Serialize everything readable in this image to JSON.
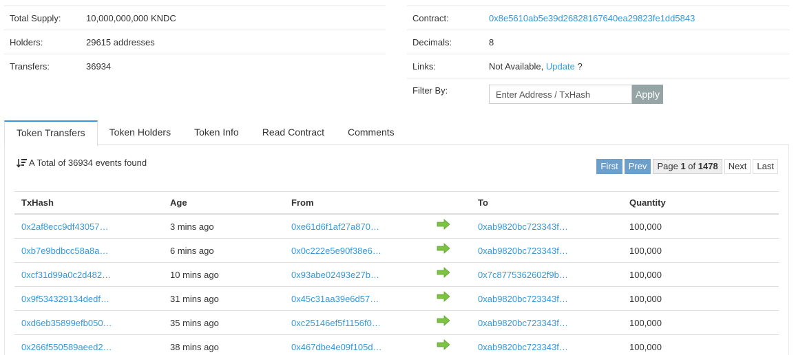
{
  "summary_left": [
    {
      "label": "Total Supply:",
      "value": "10,000,000,000 KNDC"
    },
    {
      "label": "Holders:",
      "value": "29615 addresses"
    },
    {
      "label": "Transfers:",
      "value": "36934"
    }
  ],
  "summary_right": {
    "contract_label": "Contract:",
    "contract_value": "0x8e5610ab5e39d26828167640ea29823fe1dd5843",
    "decimals_label": "Decimals:",
    "decimals_value": "8",
    "links_label": "Links:",
    "links_text": "Not Available,",
    "links_update": "Update",
    "links_q": "?",
    "filter_label": "Filter By:",
    "filter_placeholder": "Enter Address / TxHash",
    "apply_label": "Apply"
  },
  "tabs": [
    "Token Transfers",
    "Token Holders",
    "Token Info",
    "Read Contract",
    "Comments"
  ],
  "events_text": "A Total of 36934 events found",
  "pager": {
    "first": "First",
    "prev": "Prev",
    "page_prefix": "Page",
    "page_current": "1",
    "page_of": "of",
    "page_total": "1478",
    "next": "Next",
    "last": "Last"
  },
  "table": {
    "headers": [
      "TxHash",
      "Age",
      "From",
      "",
      "To",
      "Quantity"
    ],
    "rows": [
      {
        "txhash": "0x2af8ecc9df43057…",
        "age": "3 mins ago",
        "from": "0xe61d6f1af27a870…",
        "to": "0xab9820bc723343f…",
        "qty": "100,000"
      },
      {
        "txhash": "0xb7e9bdbcc58a8a…",
        "age": "6 mins ago",
        "from": "0x0c222e5e90f38e6…",
        "to": "0xab9820bc723343f…",
        "qty": "100,000"
      },
      {
        "txhash": "0xcf31d99a0c2d482…",
        "age": "10 mins ago",
        "from": "0x93abe02493e27b…",
        "to": "0x7c8775362602f9b…",
        "qty": "100,000"
      },
      {
        "txhash": "0x9f534329134dedf…",
        "age": "31 mins ago",
        "from": "0x45c31aa39e6d57…",
        "to": "0xab9820bc723343f…",
        "qty": "100,000"
      },
      {
        "txhash": "0xd6eb35899efb050…",
        "age": "35 mins ago",
        "from": "0xc25146ef5f1156f0…",
        "to": "0xab9820bc723343f…",
        "qty": "100,000"
      },
      {
        "txhash": "0x266f550589aeed2…",
        "age": "38 mins ago",
        "from": "0x467dbe4e09f105d…",
        "to": "0xab9820bc723343f…",
        "qty": "100,000"
      }
    ]
  },
  "colors": {
    "link": "#3498db",
    "arrow": "#7dc242",
    "pager_blue": "#6d9fcb",
    "apply": "#95a5a6"
  }
}
